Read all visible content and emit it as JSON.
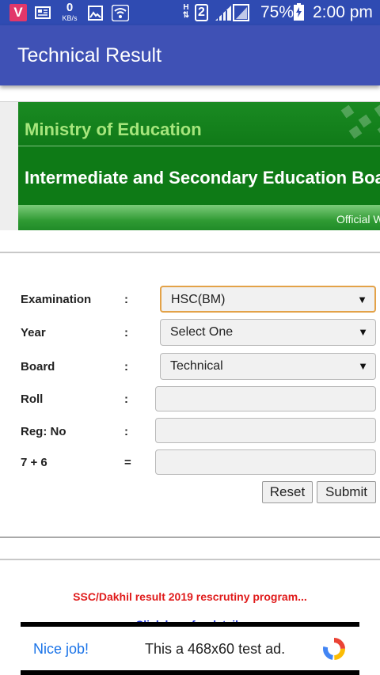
{
  "status_bar": {
    "app_badge": "V",
    "net_speed_value": "0",
    "net_speed_unit": "KB/s",
    "network_type": "H",
    "sim_slot": "2",
    "battery_percent": "75%",
    "time": "2:00 pm"
  },
  "app_bar": {
    "title": "Technical Result"
  },
  "banner": {
    "ministry": "Ministry of Education",
    "board": "Intermediate and Secondary Education Boards",
    "official": "Official W",
    "colors": {
      "green": "#0e7a16",
      "light_green": "#a6e57c"
    }
  },
  "form": {
    "examination": {
      "label": "Examination",
      "separator": ":",
      "value": "HSC(BM)"
    },
    "year": {
      "label": "Year",
      "separator": ":",
      "value": "Select One"
    },
    "board": {
      "label": "Board",
      "separator": ":",
      "value": "Technical"
    },
    "roll": {
      "label": "Roll",
      "separator": ":",
      "value": ""
    },
    "reg_no": {
      "label": "Reg: No",
      "separator": ":",
      "value": ""
    },
    "captcha": {
      "label": "7 + 6",
      "separator": "=",
      "value": ""
    },
    "reset_label": "Reset",
    "submit_label": "Submit"
  },
  "notice": {
    "text": "SSC/Dakhil result 2019 rescrutiny program...",
    "link": "Click here for details"
  },
  "ad": {
    "nice": "Nice job!",
    "text": "This a 468x60 test ad."
  },
  "colors": {
    "status_bar": "#2f4bb2",
    "app_bar": "#3f51b5",
    "notice_red": "#e01b1b",
    "link_blue": "#1a2fd6",
    "focus_orange": "#e3a248"
  }
}
